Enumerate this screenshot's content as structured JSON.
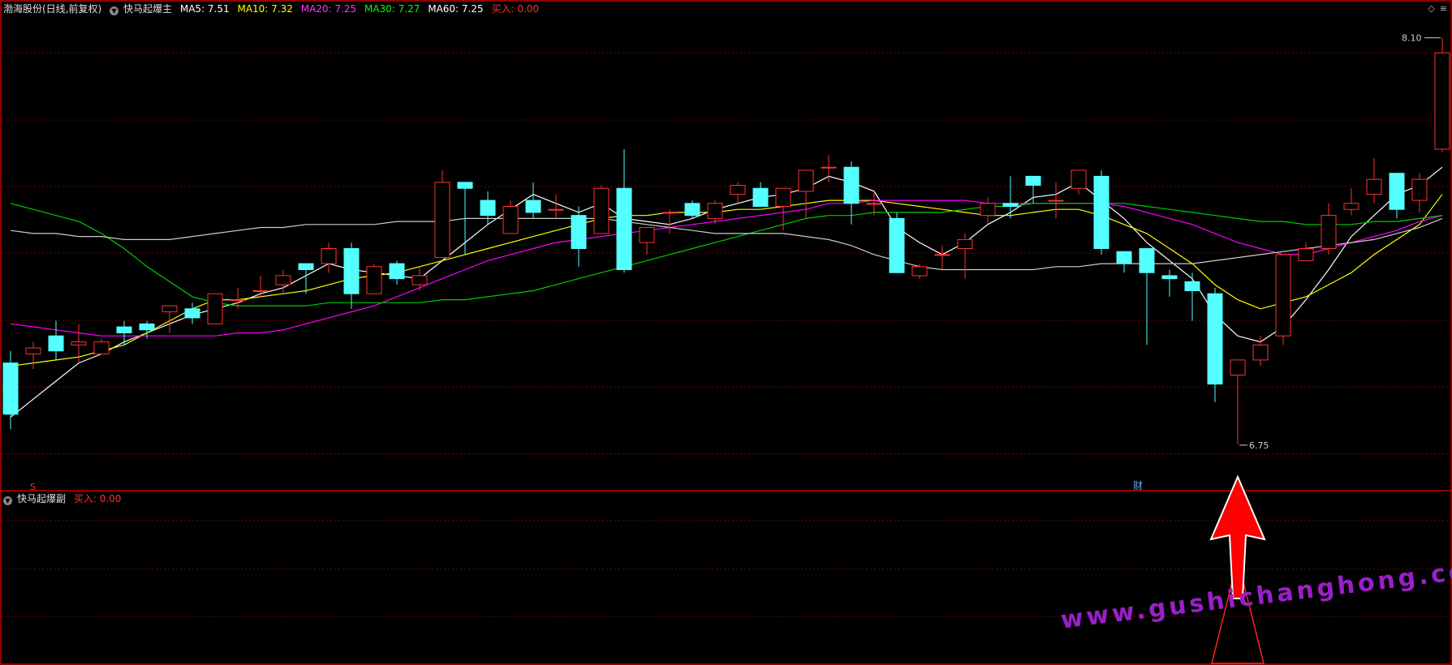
{
  "header": {
    "stock_name": "渤海股份(日线,前复权)",
    "indicator_main": "快马起爆主",
    "ma": [
      {
        "label": "MA5",
        "value": "7.51",
        "color": "#ffffff"
      },
      {
        "label": "MA10",
        "value": "7.32",
        "color": "#ffff00"
      },
      {
        "label": "MA20",
        "value": "7.25",
        "color": "#ff00ff"
      },
      {
        "label": "MA30",
        "value": "7.27",
        "color": "#00ff00"
      },
      {
        "label": "MA60",
        "value": "7.25",
        "color": "#ffffff"
      }
    ],
    "buy_label": "买入",
    "buy_value": "0.00",
    "ma5_text": "MA5: 7.51",
    "ma10_text": "MA10: 7.32",
    "ma20_text": "MA20: 7.25",
    "ma30_text": "MA30: 7.27",
    "ma60_text": "MA60: 7.25",
    "buy_text": "买入: 0.00"
  },
  "sub_header": {
    "indicator_sub": "快马起爆副",
    "buy_text": "买入: 0.00"
  },
  "annotations": {
    "high_label": "8.10",
    "low_label": "6.75",
    "signal_s": "S",
    "signal_cai": "财"
  },
  "watermark": "www.gushichanghong.com",
  "colors": {
    "up": "#ff3232",
    "down": "#54ffff",
    "grid": "#7a0000",
    "border": "#c00000",
    "arrow": "#ff0000",
    "ma5": "#ffffff",
    "ma10": "#ffff00",
    "ma20": "#ff00ff",
    "ma30": "#00cc00",
    "ma60": "#cccccc"
  },
  "chart_data": {
    "type": "candlestick",
    "price_range": [
      6.65,
      8.15
    ],
    "candles": [
      [
        7.02,
        6.85,
        6.8,
        7.06
      ],
      [
        7.05,
        7.07,
        7.0,
        7.09
      ],
      [
        7.11,
        7.06,
        7.03,
        7.16
      ],
      [
        7.08,
        7.09,
        7.02,
        7.15
      ],
      [
        7.05,
        7.09,
        7.05,
        7.1
      ],
      [
        7.14,
        7.12,
        7.08,
        7.16
      ],
      [
        7.15,
        7.13,
        7.1,
        7.16
      ],
      [
        7.19,
        7.21,
        7.12,
        7.2
      ],
      [
        7.2,
        7.17,
        7.15,
        7.22
      ],
      [
        7.15,
        7.25,
        7.15,
        7.25
      ],
      [
        7.23,
        7.23,
        7.2,
        7.27
      ],
      [
        7.26,
        7.26,
        7.24,
        7.31
      ],
      [
        7.28,
        7.31,
        7.25,
        7.33
      ],
      [
        7.35,
        7.33,
        7.25,
        7.35
      ],
      [
        7.35,
        7.4,
        7.32,
        7.42
      ],
      [
        7.4,
        7.25,
        7.2,
        7.42
      ],
      [
        7.25,
        7.34,
        7.25,
        7.35
      ],
      [
        7.35,
        7.3,
        7.28,
        7.36
      ],
      [
        7.28,
        7.31,
        7.26,
        7.34
      ],
      [
        7.37,
        7.62,
        7.37,
        7.66
      ],
      [
        7.62,
        7.6,
        7.38,
        7.62
      ],
      [
        7.56,
        7.51,
        7.48,
        7.59
      ],
      [
        7.45,
        7.54,
        7.45,
        7.56
      ],
      [
        7.56,
        7.52,
        7.5,
        7.62
      ],
      [
        7.53,
        7.53,
        7.5,
        7.58
      ],
      [
        7.51,
        7.4,
        7.34,
        7.54
      ],
      [
        7.45,
        7.6,
        7.45,
        7.61
      ],
      [
        7.6,
        7.33,
        7.32,
        7.73
      ],
      [
        7.42,
        7.47,
        7.38,
        7.47
      ],
      [
        7.52,
        7.52,
        7.45,
        7.53
      ],
      [
        7.55,
        7.51,
        7.5,
        7.56
      ],
      [
        7.5,
        7.55,
        7.48,
        7.56
      ],
      [
        7.58,
        7.61,
        7.55,
        7.62
      ],
      [
        7.6,
        7.54,
        7.54,
        7.62
      ],
      [
        7.54,
        7.6,
        7.46,
        7.59
      ],
      [
        7.59,
        7.66,
        7.5,
        7.66
      ],
      [
        7.67,
        7.67,
        7.62,
        7.71
      ],
      [
        7.67,
        7.55,
        7.48,
        7.69
      ],
      [
        7.55,
        7.55,
        7.51,
        7.59
      ],
      [
        7.5,
        7.32,
        7.32,
        7.52
      ],
      [
        7.31,
        7.34,
        7.3,
        7.35
      ],
      [
        7.38,
        7.38,
        7.33,
        7.41
      ],
      [
        7.4,
        7.43,
        7.3,
        7.45
      ],
      [
        7.51,
        7.55,
        7.48,
        7.57
      ],
      [
        7.55,
        7.54,
        7.5,
        7.64
      ],
      [
        7.64,
        7.61,
        7.55,
        7.64
      ],
      [
        7.56,
        7.56,
        7.5,
        7.62
      ],
      [
        7.6,
        7.66,
        7.58,
        7.64
      ],
      [
        7.64,
        7.4,
        7.38,
        7.66
      ],
      [
        7.39,
        7.35,
        7.32,
        7.39
      ],
      [
        7.4,
        7.32,
        7.08,
        7.4
      ],
      [
        7.31,
        7.3,
        7.24,
        7.33
      ],
      [
        7.29,
        7.26,
        7.16,
        7.32
      ],
      [
        7.25,
        6.95,
        6.89,
        7.27
      ],
      [
        6.98,
        7.03,
        6.75,
        7.03
      ],
      [
        7.03,
        7.08,
        7.01,
        7.11
      ],
      [
        7.11,
        7.38,
        7.08,
        7.38
      ],
      [
        7.36,
        7.4,
        7.36,
        7.42
      ],
      [
        7.4,
        7.51,
        7.38,
        7.55
      ],
      [
        7.53,
        7.55,
        7.51,
        7.6
      ],
      [
        7.58,
        7.63,
        7.55,
        7.7
      ],
      [
        7.65,
        7.53,
        7.5,
        7.65
      ],
      [
        7.56,
        7.63,
        7.52,
        7.65
      ],
      [
        7.73,
        8.05,
        7.72,
        8.1
      ]
    ],
    "series": [
      {
        "name": "MA5",
        "values": [
          6.84,
          6.9,
          6.96,
          7.02,
          7.05,
          7.09,
          7.12,
          7.15,
          7.18,
          7.2,
          7.22,
          7.25,
          7.27,
          7.31,
          7.35,
          7.33,
          7.32,
          7.31,
          7.3,
          7.36,
          7.42,
          7.48,
          7.53,
          7.58,
          7.55,
          7.52,
          7.55,
          7.5,
          7.49,
          7.48,
          7.5,
          7.53,
          7.55,
          7.57,
          7.58,
          7.6,
          7.64,
          7.62,
          7.59,
          7.47,
          7.42,
          7.38,
          7.42,
          7.48,
          7.52,
          7.57,
          7.58,
          7.62,
          7.56,
          7.5,
          7.42,
          7.36,
          7.3,
          7.18,
          7.11,
          7.09,
          7.14,
          7.23,
          7.33,
          7.44,
          7.51,
          7.58,
          7.61,
          7.67
        ]
      },
      {
        "name": "MA10",
        "values": [
          7.01,
          7.02,
          7.03,
          7.04,
          7.06,
          7.08,
          7.12,
          7.16,
          7.2,
          7.23,
          7.23,
          7.24,
          7.25,
          7.26,
          7.28,
          7.3,
          7.31,
          7.32,
          7.34,
          7.36,
          7.38,
          7.4,
          7.42,
          7.44,
          7.46,
          7.48,
          7.5,
          7.51,
          7.51,
          7.52,
          7.52,
          7.52,
          7.53,
          7.53,
          7.54,
          7.55,
          7.56,
          7.56,
          7.56,
          7.55,
          7.54,
          7.53,
          7.52,
          7.51,
          7.51,
          7.52,
          7.53,
          7.53,
          7.51,
          7.48,
          7.45,
          7.4,
          7.35,
          7.28,
          7.23,
          7.2,
          7.22,
          7.24,
          7.28,
          7.32,
          7.38,
          7.43,
          7.48,
          7.58
        ]
      },
      {
        "name": "MA20",
        "values": [
          7.15,
          7.14,
          7.13,
          7.12,
          7.11,
          7.11,
          7.11,
          7.11,
          7.11,
          7.11,
          7.12,
          7.12,
          7.13,
          7.15,
          7.17,
          7.19,
          7.21,
          7.24,
          7.27,
          7.3,
          7.33,
          7.36,
          7.38,
          7.4,
          7.42,
          7.43,
          7.44,
          7.45,
          7.46,
          7.47,
          7.48,
          7.49,
          7.5,
          7.51,
          7.52,
          7.53,
          7.55,
          7.55,
          7.56,
          7.56,
          7.56,
          7.56,
          7.56,
          7.55,
          7.55,
          7.55,
          7.55,
          7.55,
          7.55,
          7.54,
          7.52,
          7.5,
          7.48,
          7.45,
          7.42,
          7.4,
          7.38,
          7.38,
          7.4,
          7.42,
          7.44,
          7.46,
          7.49,
          7.51
        ]
      },
      {
        "name": "MA30",
        "values": [
          7.55,
          7.53,
          7.51,
          7.49,
          7.45,
          7.4,
          7.34,
          7.29,
          7.24,
          7.22,
          7.21,
          7.21,
          7.21,
          7.21,
          7.22,
          7.22,
          7.22,
          7.22,
          7.22,
          7.23,
          7.23,
          7.24,
          7.25,
          7.26,
          7.28,
          7.3,
          7.32,
          7.34,
          7.36,
          7.38,
          7.4,
          7.42,
          7.44,
          7.46,
          7.48,
          7.5,
          7.51,
          7.51,
          7.52,
          7.52,
          7.52,
          7.52,
          7.53,
          7.54,
          7.54,
          7.55,
          7.55,
          7.55,
          7.55,
          7.55,
          7.54,
          7.53,
          7.52,
          7.51,
          7.5,
          7.49,
          7.49,
          7.48,
          7.48,
          7.48,
          7.49,
          7.49,
          7.5,
          7.51
        ]
      },
      {
        "name": "MA60",
        "values": [
          7.46,
          7.45,
          7.45,
          7.44,
          7.44,
          7.43,
          7.43,
          7.43,
          7.44,
          7.45,
          7.46,
          7.47,
          7.47,
          7.48,
          7.48,
          7.48,
          7.48,
          7.49,
          7.49,
          7.49,
          7.5,
          7.5,
          7.5,
          7.5,
          7.5,
          7.5,
          7.5,
          7.49,
          7.48,
          7.47,
          7.46,
          7.45,
          7.45,
          7.45,
          7.45,
          7.44,
          7.43,
          7.41,
          7.38,
          7.36,
          7.34,
          7.33,
          7.33,
          7.33,
          7.33,
          7.33,
          7.34,
          7.34,
          7.35,
          7.35,
          7.35,
          7.35,
          7.35,
          7.36,
          7.37,
          7.38,
          7.39,
          7.4,
          7.41,
          7.42,
          7.43,
          7.45,
          7.47,
          7.5
        ]
      }
    ]
  }
}
